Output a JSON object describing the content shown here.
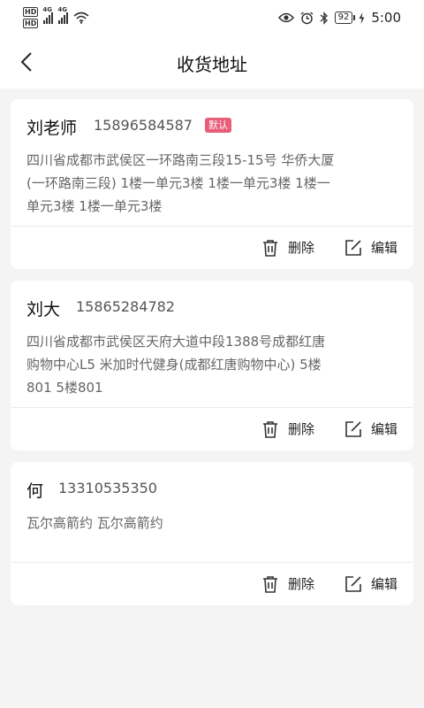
{
  "status_bar": {
    "hd1": "HD",
    "hd2": "HD",
    "net1": "4G",
    "net2": "4G",
    "battery": "92",
    "time": "5:00"
  },
  "header": {
    "title": "收货地址"
  },
  "addresses": [
    {
      "name": "刘老师",
      "phone": "15896584587",
      "default_label": "默认",
      "address": "四川省成都市武侯区一环路南三段15-15号 华侨大厦(一环路南三段) 1楼一单元3楼 1楼一单元3楼 1楼一单元3楼 1楼一单元3楼",
      "delete_label": "删除",
      "edit_label": "编辑"
    },
    {
      "name": "刘大",
      "phone": "15865284782",
      "address": "四川省成都市武侯区天府大道中段1388号成都红唐购物中心L5 米加时代健身(成都红唐购物中心) 5楼801 5楼801",
      "delete_label": "删除",
      "edit_label": "编辑"
    },
    {
      "name": "何",
      "phone": "13310535350",
      "address": "瓦尔高箭约 瓦尔高箭约",
      "delete_label": "删除",
      "edit_label": "编辑"
    }
  ],
  "colors": {
    "background": "#f4f4f4",
    "badge": "#e85d78",
    "card": "#ffffff"
  }
}
